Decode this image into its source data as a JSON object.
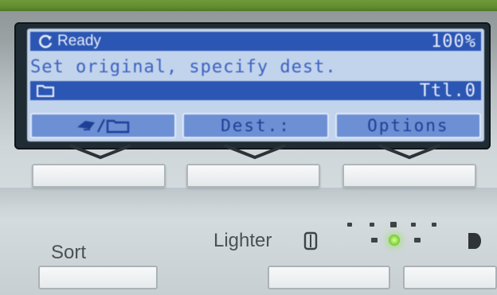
{
  "lcd": {
    "status": {
      "text": "Ready",
      "value": "100%",
      "icon": "refresh-icon"
    },
    "message": "Set original, specify dest.",
    "file_line": {
      "icon": "folder-icon",
      "value": "Ttl.0"
    },
    "tabs": [
      {
        "label": "",
        "icon": "scanner-folder-icon"
      },
      {
        "label": "Dest.:"
      },
      {
        "label": "Options"
      }
    ]
  },
  "panel": {
    "sort_label": "Sort",
    "lighter_label": "Lighter",
    "density_level_index": 3,
    "density_levels": 5
  },
  "colors": {
    "lcd_background": "#c2d3ec",
    "lcd_highlight": "#2c56b3",
    "lcd_text": "#3b62c0",
    "led_green": "#86d640",
    "top_strip_green": "#5f8a30"
  }
}
